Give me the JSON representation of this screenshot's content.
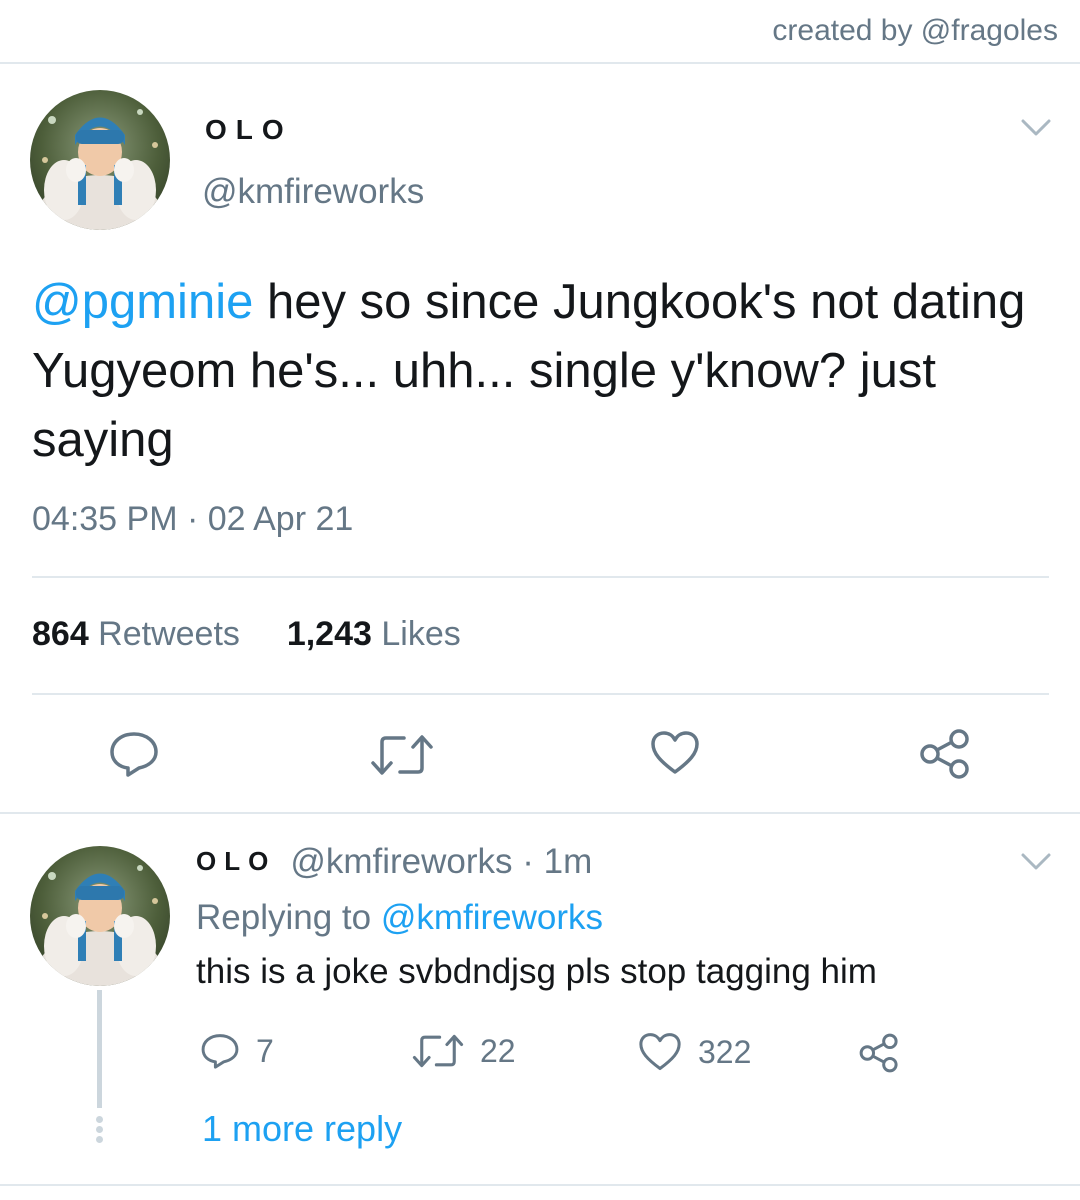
{
  "credit": "created by @fragoles",
  "tweet": {
    "display_name": "OLO",
    "handle": "@kmfireworks",
    "mention": "@pgminie",
    "text": " hey so since Jungkook's not dating Yugyeom he's... uhh... single y'know? just saying",
    "timestamp": "04:35 PM · 02 Apr 21",
    "retweets_count": "864",
    "retweets_label": " Retweets",
    "likes_count": "1,243",
    "likes_label": " Likes",
    "icons": [
      "reply-icon",
      "retweet-icon",
      "like-icon",
      "share-icon",
      "chevron-down-icon"
    ]
  },
  "reply": {
    "display_name": "OLO",
    "handle": "@kmfireworks",
    "time": " · 1m",
    "replying_prefix": "Replying to ",
    "replying_to": "@kmfireworks",
    "text": "this is a joke svbdndjsg pls stop tagging him",
    "reply_count": "7",
    "retweet_count": "22",
    "like_count": "322",
    "more_replies": "1 more reply"
  },
  "colors": {
    "accent": "#1da1f2",
    "secondary_text": "#657786",
    "divider": "#e1e8ed",
    "icon": "#657786"
  }
}
